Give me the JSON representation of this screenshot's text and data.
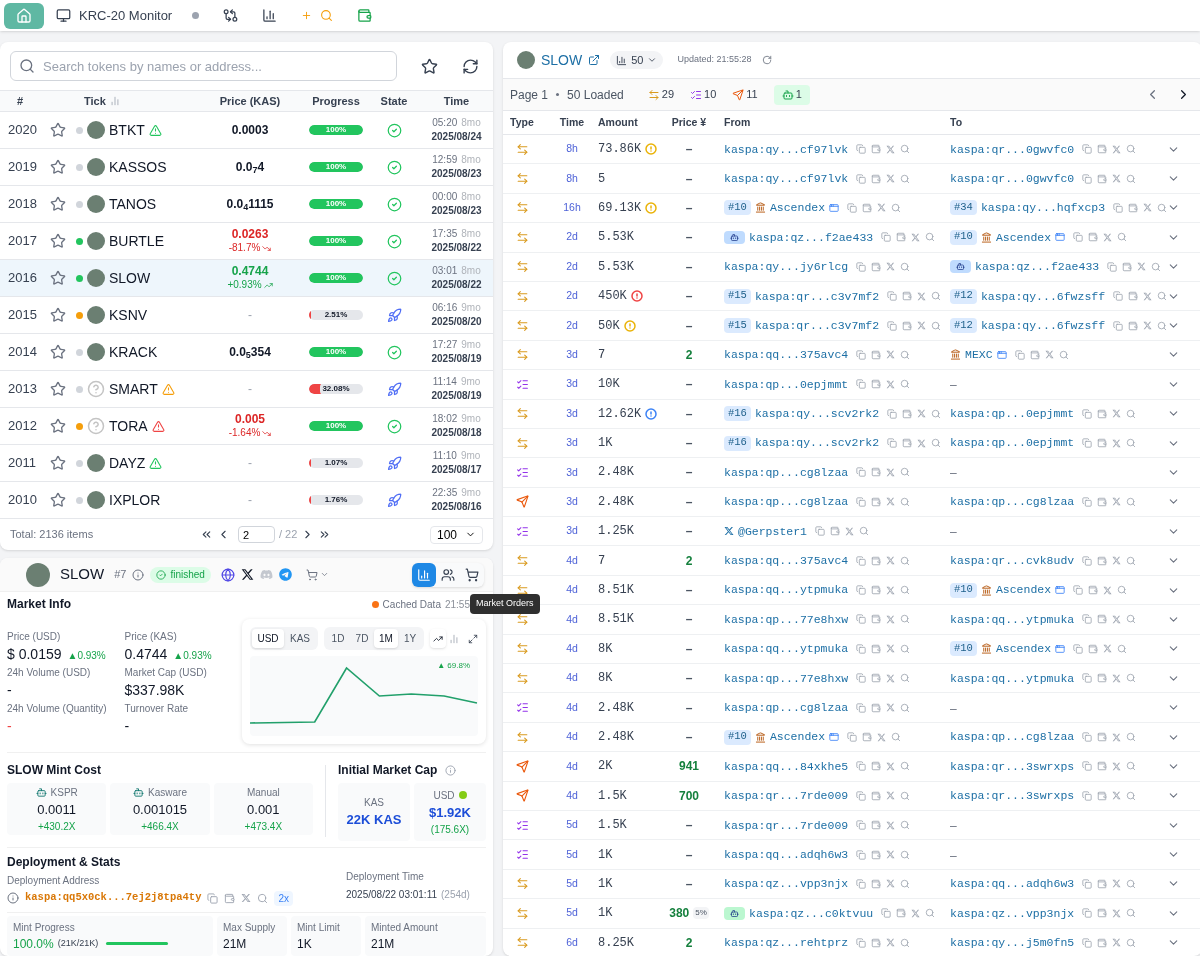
{
  "nav": [
    {
      "kind": "home",
      "selected": true
    },
    {
      "kind": "monitor",
      "label": "KRC-20 Monitor",
      "selected": false
    },
    {
      "kind": "swap",
      "selected": false
    },
    {
      "kind": "chart",
      "selected": false
    },
    {
      "kind": "add-search",
      "selected": false
    },
    {
      "kind": "wallet",
      "selected": false
    }
  ],
  "token_list": {
    "search": {
      "placeholder": "Search tokens by names or address..."
    },
    "columns": [
      "#",
      "Tick",
      "Price (KAS)",
      "Progress",
      "State",
      "Time"
    ],
    "rows": [
      {
        "id": "2020",
        "tick": "BTKT",
        "color": "#d1d5db",
        "avatar_known": true,
        "warning": {
          "color": "#22c55e"
        },
        "price": "0.0003",
        "priced": true,
        "progress": "100%",
        "level": 1,
        "finished": true,
        "clock": "05:20",
        "age": "8mo",
        "date": "2025/08/24",
        "selected": false
      },
      {
        "id": "2019",
        "tick": "KASSOS",
        "color": "#d1d5db",
        "avatar_known": true,
        "price": "0.0$_{7}$4",
        "priced": true,
        "progress": "100%",
        "level": 1,
        "finished": true,
        "clock": "12:59",
        "age": "8mo",
        "date": "2025/08/23",
        "selected": false
      },
      {
        "id": "2018",
        "tick": "TANOS",
        "color": "#d1d5db",
        "avatar_known": true,
        "price": "0.0$_{4}$1115",
        "priced": true,
        "progress": "100%",
        "level": 1,
        "finished": true,
        "clock": "00:00",
        "age": "8mo",
        "date": "2025/08/23",
        "selected": false
      },
      {
        "id": "2017",
        "tick": "BURTLE",
        "color": "#22c55e",
        "avatar_known": true,
        "price": "0.0263",
        "priced": true,
        "rising": false,
        "change": "-81.7%",
        "progress": "100%",
        "level": 1,
        "finished": true,
        "clock": "17:35",
        "age": "8mo",
        "date": "2025/08/22",
        "selected": false
      },
      {
        "id": "2016",
        "tick": "SLOW",
        "color": "#22c55e",
        "avatar_known": true,
        "price": "0.4744",
        "priced": true,
        "rising": true,
        "change": "+0.93%",
        "progress": "100%",
        "level": 1,
        "finished": true,
        "clock": "03:01",
        "age": "8mo",
        "date": "2025/08/22",
        "selected": true
      },
      {
        "id": "2015",
        "tick": "KSNV",
        "color": "#f59e0b",
        "avatar_known": true,
        "price": "-",
        "priced": false,
        "progress": "2.51%",
        "level": 0.0251,
        "finished": false,
        "clock": "06:16",
        "age": "9mo",
        "date": "2025/08/20",
        "selected": false
      },
      {
        "id": "2014",
        "tick": "KRACK",
        "color": "#d1d5db",
        "avatar_known": true,
        "price": "0.0$_{5}$354",
        "priced": true,
        "progress": "100%",
        "level": 1,
        "finished": true,
        "clock": "17:27",
        "age": "9mo",
        "date": "2025/08/19",
        "selected": false
      },
      {
        "id": "2013",
        "tick": "SMART",
        "color": "#d1d5db",
        "avatar_known": false,
        "warning": {
          "color": "#f59e0b"
        },
        "price": "-",
        "priced": false,
        "progress": "32.08%",
        "level": 0.3208,
        "finished": false,
        "clock": "11:14",
        "age": "9mo",
        "date": "2025/08/19",
        "selected": false
      },
      {
        "id": "2012",
        "tick": "TORA",
        "color": "#f59e0b",
        "avatar_known": false,
        "warning": {
          "color": "#ef4444"
        },
        "price": "0.005",
        "priced": true,
        "rising": false,
        "change": "-1.64%",
        "progress": "100%",
        "level": 1,
        "finished": true,
        "clock": "18:02",
        "age": "9mo",
        "date": "2025/08/18",
        "selected": false
      },
      {
        "id": "2011",
        "tick": "DAYZ",
        "color": "#d1d5db",
        "avatar_known": true,
        "warning": {
          "color": "#22c55e"
        },
        "price": "-",
        "priced": false,
        "progress": "1.07%",
        "level": 0.0107,
        "finished": false,
        "clock": "11:10",
        "age": "9mo",
        "date": "2025/08/17",
        "selected": false
      },
      {
        "id": "2010",
        "tick": "IXPLOR",
        "color": "#d1d5db",
        "avatar_known": true,
        "price": "-",
        "priced": false,
        "progress": "1.76%",
        "level": 0.0176,
        "finished": false,
        "clock": "22:35",
        "age": "9mo",
        "date": "2025/08/16",
        "selected": false
      }
    ],
    "total": "Total: 2136 items",
    "page": "2",
    "pages": "/ 22",
    "page_size": "100"
  },
  "token": {
    "name": "SLOW",
    "rank": "#7",
    "status": "finished",
    "tabs": [
      {
        "kind": "chart",
        "selected": true
      },
      {
        "kind": "holders",
        "selected": false
      },
      {
        "kind": "orders",
        "selected": false
      }
    ],
    "tooltip": "Market Orders",
    "market": {
      "title": "Market Info",
      "cache": "Cached Data",
      "cache_time": "21:55",
      "stats": [
        {
          "label": "Price (USD)",
          "value": "$ 0.0159",
          "change": "▲0.93%",
          "negative": false
        },
        {
          "label": "Price (KAS)",
          "value": "0.4744",
          "change": "▲0.93%",
          "negative": false
        },
        {
          "label": "24h Volume (USD)",
          "value": "-",
          "negative": false
        },
        {
          "label": "Market Cap (USD)",
          "value": "$337.98K",
          "negative": false
        },
        {
          "label": "24h Volume (Quantity)",
          "value": "-",
          "negative": true
        },
        {
          "label": "Turnover Rate",
          "value": "-",
          "negative": false
        }
      ],
      "chart": {
        "currencies": [
          {
            "label": "USD",
            "selected": true
          },
          {
            "label": "KAS",
            "selected": false
          }
        ],
        "ranges": [
          {
            "label": "1D",
            "selected": false
          },
          {
            "label": "7D",
            "selected": false
          },
          {
            "label": "1M",
            "selected": true
          },
          {
            "label": "1Y",
            "selected": false
          }
        ],
        "modes": [
          {
            "kind": "line",
            "selected": true
          },
          {
            "kind": "bar",
            "selected": false
          }
        ],
        "badge": "▲ 69.8%"
      }
    },
    "mint_cost": {
      "title": "SLOW Mint Cost",
      "cards": [
        {
          "label": "KSPR",
          "logo": true,
          "value": "0.0011",
          "multiple": "+430.2X"
        },
        {
          "label": "Kasware",
          "logo": true,
          "value": "0.001015",
          "multiple": "+466.4X"
        },
        {
          "label": "Manual",
          "logo": false,
          "value": "0.001",
          "multiple": "+473.4X"
        }
      ]
    },
    "initial_cap": {
      "title": "Initial Market Cap",
      "cards": [
        {
          "label": "KAS",
          "logo": false,
          "value": "22K KAS"
        },
        {
          "label": "USD",
          "logo": true,
          "value": "$1.92K",
          "note": "(175.6X)"
        }
      ]
    },
    "deployment": {
      "title": "Deployment & Stats",
      "address_label": "Deployment Address",
      "address": "kaspa:qq5x0ck...7ej2j8tpa4ty",
      "badge": "2x",
      "time_label": "Deployment Time",
      "time": "2025/08/22 03:01:11",
      "age": "(254d)",
      "stats": [
        {
          "label": "Mint Progress",
          "value": "100.0%",
          "detail": "(21K/21K)",
          "level": 1
        },
        {
          "label": "Max Supply",
          "value": "21M"
        },
        {
          "label": "Mint Limit",
          "value": "1K"
        },
        {
          "label": "Minted Amount",
          "value": "21M"
        }
      ]
    }
  },
  "activity": {
    "token": "SLOW",
    "holders": "50",
    "updated": "Updated: 21:55:28",
    "page": "Page 1",
    "loaded": "50 Loaded",
    "counts": [
      {
        "kind": "transfer",
        "count": "29"
      },
      {
        "kind": "mint",
        "count": "10"
      },
      {
        "kind": "send",
        "count": "11"
      },
      {
        "kind": "bot",
        "count": "1"
      }
    ],
    "columns": [
      "Type",
      "Time",
      "Amount",
      "Price ¥",
      "From",
      "To"
    ],
    "rows": [
      {
        "kind": "transfer",
        "time": "8h",
        "amount": "73.86K",
        "alert": {
          "color": "#eab308"
        },
        "price": "–",
        "priced": false,
        "from": {
          "kind": "address",
          "text": "kaspa:qy...cf97lvk"
        },
        "to": {
          "kind": "address",
          "text": "kaspa:qr...0gwvfc0"
        }
      },
      {
        "kind": "transfer",
        "time": "8h",
        "amount": "5",
        "price": "–",
        "priced": false,
        "from": {
          "kind": "address",
          "text": "kaspa:qy...cf97lvk"
        },
        "to": {
          "kind": "address",
          "text": "kaspa:qr...0gwvfc0"
        }
      },
      {
        "kind": "transfer",
        "time": "16h",
        "amount": "69.13K",
        "alert": {
          "color": "#eab308"
        },
        "price": "–",
        "priced": false,
        "from": {
          "kind": "exchange",
          "rank": "#10",
          "text": "Ascendex"
        },
        "to": {
          "kind": "address",
          "rank": "#34",
          "text": "kaspa:qy...hqfxcp3"
        }
      },
      {
        "kind": "transfer",
        "time": "2d",
        "amount": "5.53K",
        "price": "–",
        "priced": false,
        "from": {
          "kind": "address",
          "bot": {
            "color": "#bfdbfe"
          },
          "text": "kaspa:qz...f2ae433"
        },
        "to": {
          "kind": "exchange",
          "rank": "#10",
          "text": "Ascendex"
        }
      },
      {
        "kind": "transfer",
        "time": "2d",
        "amount": "5.53K",
        "price": "–",
        "priced": false,
        "from": {
          "kind": "address",
          "text": "kaspa:qy...jy6rlcg"
        },
        "to": {
          "kind": "address",
          "bot": {
            "color": "#bfdbfe"
          },
          "text": "kaspa:qz...f2ae433"
        }
      },
      {
        "kind": "transfer",
        "time": "2d",
        "amount": "450K",
        "alert": {
          "color": "#ef4444"
        },
        "price": "–",
        "priced": false,
        "from": {
          "kind": "address",
          "rank": "#15",
          "text": "kaspa:qr...c3v7mf2"
        },
        "to": {
          "kind": "address",
          "rank": "#12",
          "text": "kaspa:qy...6fwzsff"
        }
      },
      {
        "kind": "transfer",
        "time": "2d",
        "amount": "50K",
        "alert": {
          "color": "#eab308"
        },
        "price": "–",
        "priced": false,
        "from": {
          "kind": "address",
          "rank": "#15",
          "text": "kaspa:qr...c3v7mf2"
        },
        "to": {
          "kind": "address",
          "rank": "#12",
          "text": "kaspa:qy...6fwzsff"
        }
      },
      {
        "kind": "transfer",
        "time": "3d",
        "amount": "7",
        "price": "2",
        "priced": true,
        "from": {
          "kind": "address",
          "text": "kaspa:qq...375avc4"
        },
        "to": {
          "kind": "exchange",
          "text": "MEXC"
        }
      },
      {
        "kind": "mint",
        "time": "3d",
        "amount": "10K",
        "price": "–",
        "priced": false,
        "from": {
          "kind": "address",
          "text": "kaspa:qp...0epjmmt"
        },
        "to": {
          "kind": "none",
          "text": "–"
        }
      },
      {
        "kind": "transfer",
        "time": "3d",
        "amount": "12.62K",
        "alert": {
          "color": "#3b82f6"
        },
        "price": "–",
        "priced": false,
        "from": {
          "kind": "address",
          "rank": "#16",
          "text": "kaspa:qy...scv2rk2"
        },
        "to": {
          "kind": "address",
          "text": "kaspa:qp...0epjmmt"
        }
      },
      {
        "kind": "transfer",
        "time": "3d",
        "amount": "1K",
        "price": "–",
        "priced": false,
        "from": {
          "kind": "address",
          "rank": "#16",
          "text": "kaspa:qy...scv2rk2"
        },
        "to": {
          "kind": "address",
          "text": "kaspa:qp...0epjmmt"
        }
      },
      {
        "kind": "mint",
        "time": "3d",
        "amount": "2.48K",
        "price": "–",
        "priced": false,
        "from": {
          "kind": "address",
          "text": "kaspa:qp...cg8lzaa"
        },
        "to": {
          "kind": "none",
          "text": "–"
        }
      },
      {
        "kind": "send",
        "time": "3d",
        "amount": "2.48K",
        "price": "–",
        "priced": false,
        "from": {
          "kind": "address",
          "text": "kaspa:qp...cg8lzaa"
        },
        "to": {
          "kind": "address",
          "text": "kaspa:qp...cg8lzaa"
        }
      },
      {
        "kind": "mint",
        "time": "3d",
        "amount": "1.25K",
        "price": "–",
        "priced": false,
        "from": {
          "kind": "twitter",
          "text": "@Gerpster1"
        },
        "to": {
          "kind": "none",
          "text": "–"
        }
      },
      {
        "kind": "transfer",
        "time": "4d",
        "amount": "7",
        "price": "2",
        "priced": true,
        "from": {
          "kind": "address",
          "text": "kaspa:qq...375avc4"
        },
        "to": {
          "kind": "address",
          "text": "kaspa:qr...cvk8udv"
        }
      },
      {
        "kind": "transfer",
        "time": "4d",
        "amount": "8.51K",
        "price": "–",
        "priced": false,
        "from": {
          "kind": "address",
          "text": "kaspa:qq...ytpmuka"
        },
        "to": {
          "kind": "exchange",
          "rank": "#10",
          "text": "Ascendex"
        }
      },
      {
        "kind": "transfer",
        "time": "4d",
        "amount": "8.51K",
        "price": "–",
        "priced": false,
        "from": {
          "kind": "address",
          "text": "kaspa:qp...77e8hxw"
        },
        "to": {
          "kind": "address",
          "text": "kaspa:qq...ytpmuka"
        }
      },
      {
        "kind": "transfer",
        "time": "4d",
        "amount": "8K",
        "price": "–",
        "priced": false,
        "from": {
          "kind": "address",
          "text": "kaspa:qq...ytpmuka"
        },
        "to": {
          "kind": "exchange",
          "rank": "#10",
          "text": "Ascendex"
        }
      },
      {
        "kind": "transfer",
        "time": "4d",
        "amount": "8K",
        "price": "–",
        "priced": false,
        "from": {
          "kind": "address",
          "text": "kaspa:qp...77e8hxw"
        },
        "to": {
          "kind": "address",
          "text": "kaspa:qq...ytpmuka"
        }
      },
      {
        "kind": "mint",
        "time": "4d",
        "amount": "2.48K",
        "price": "–",
        "priced": false,
        "from": {
          "kind": "address",
          "text": "kaspa:qp...cg8lzaa"
        },
        "to": {
          "kind": "none",
          "text": "–"
        }
      },
      {
        "kind": "transfer",
        "time": "4d",
        "amount": "2.48K",
        "price": "–",
        "priced": false,
        "from": {
          "kind": "exchange",
          "rank": "#10",
          "text": "Ascendex"
        },
        "to": {
          "kind": "address",
          "text": "kaspa:qp...cg8lzaa"
        }
      },
      {
        "kind": "send",
        "time": "4d",
        "amount": "2K",
        "price": "941",
        "priced": true,
        "from": {
          "kind": "address",
          "text": "kaspa:qq...84xkhe5"
        },
        "to": {
          "kind": "address",
          "text": "kaspa:qr...3swrxps"
        }
      },
      {
        "kind": "send",
        "time": "4d",
        "amount": "1.5K",
        "price": "700",
        "priced": true,
        "from": {
          "kind": "address",
          "text": "kaspa:qr...7rde009"
        },
        "to": {
          "kind": "address",
          "text": "kaspa:qr...3swrxps"
        }
      },
      {
        "kind": "mint",
        "time": "5d",
        "amount": "1.5K",
        "price": "–",
        "priced": false,
        "from": {
          "kind": "address",
          "text": "kaspa:qr...7rde009"
        },
        "to": {
          "kind": "none",
          "text": "–"
        }
      },
      {
        "kind": "mint",
        "time": "5d",
        "amount": "1K",
        "price": "–",
        "priced": false,
        "from": {
          "kind": "address",
          "text": "kaspa:qq...adqh6w3"
        },
        "to": {
          "kind": "none",
          "text": "–"
        }
      },
      {
        "kind": "transfer",
        "time": "5d",
        "amount": "1K",
        "price": "–",
        "priced": false,
        "from": {
          "kind": "address",
          "text": "kaspa:qz...vpp3njx"
        },
        "to": {
          "kind": "address",
          "text": "kaspa:qq...adqh6w3"
        }
      },
      {
        "kind": "transfer",
        "time": "5d",
        "amount": "1K",
        "price": "380",
        "priced": true,
        "price_badge": "5%",
        "from": {
          "kind": "address",
          "bot": {
            "color": "#bbf7d0"
          },
          "text": "kaspa:qz...c0ktvuu"
        },
        "to": {
          "kind": "address",
          "text": "kaspa:qz...vpp3njx"
        }
      },
      {
        "kind": "transfer",
        "time": "6d",
        "amount": "8.25K",
        "price": "2",
        "priced": true,
        "from": {
          "kind": "address",
          "text": "kaspa:qz...rehtprz"
        },
        "to": {
          "kind": "address",
          "text": "kaspa:qy...j5m0fn5"
        }
      }
    ]
  }
}
